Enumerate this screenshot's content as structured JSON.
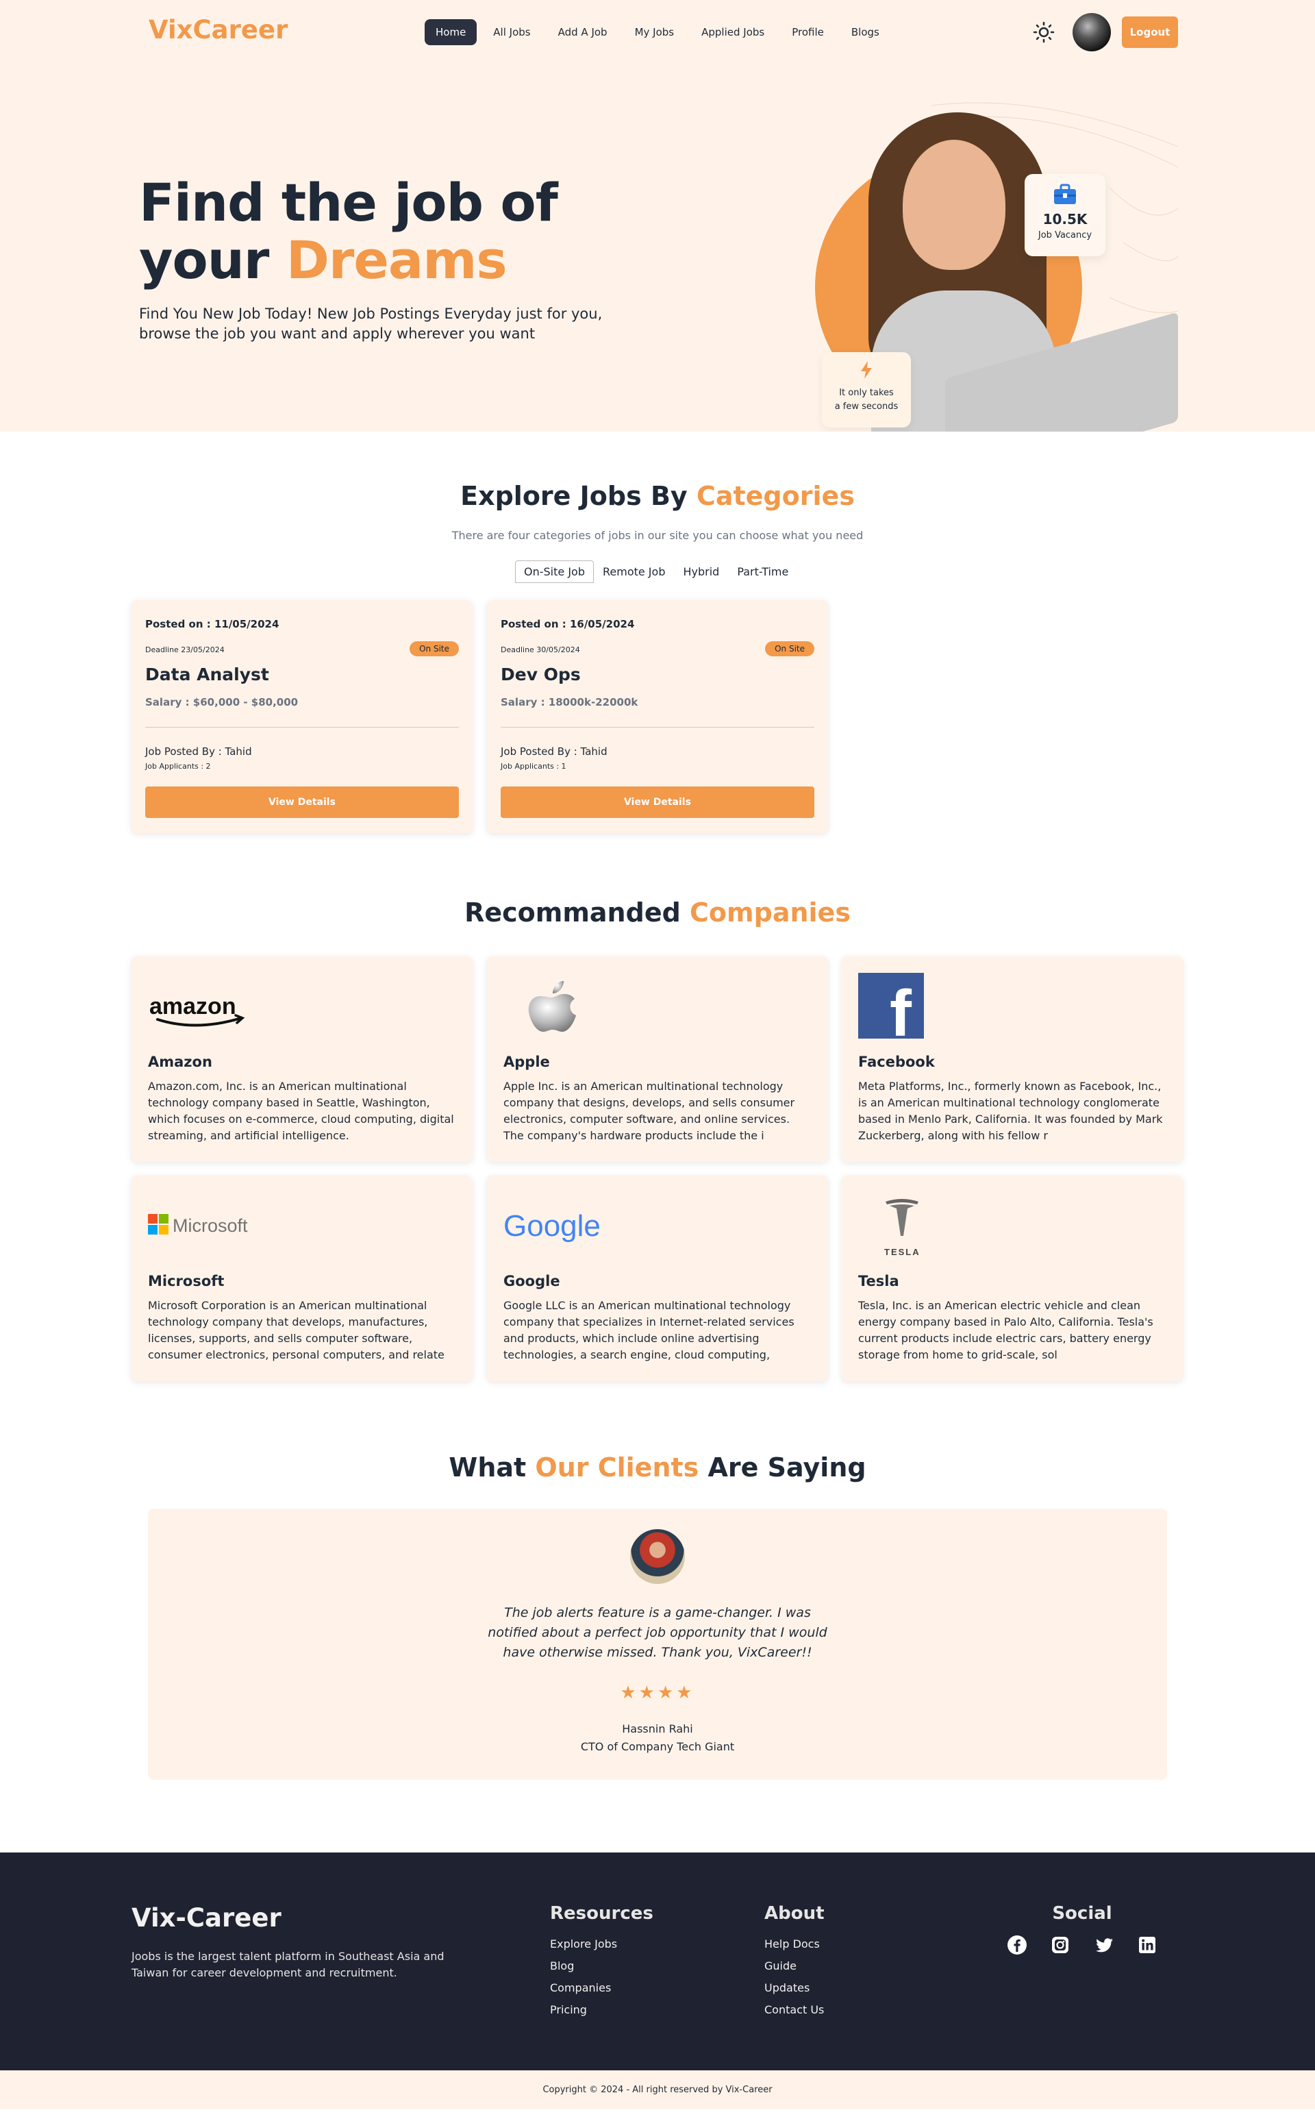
{
  "nav": {
    "brand": "VixCareer",
    "items": [
      "Home",
      "All Jobs",
      "Add A Job",
      "My Jobs",
      "Applied Jobs",
      "Profile",
      "Blogs"
    ],
    "active": "Home",
    "logout_label": "Logout"
  },
  "hero": {
    "title_line1": "Find the job of",
    "title_line2_plain": "your ",
    "title_line2_accent": "Dreams",
    "subtitle": "Find You New Job Today! New Job Postings Everyday just for you, browse the job you want and apply wherever you want",
    "vacancy_count": "10.5K",
    "vacancy_label": "Job Vacancy",
    "fast_label_line1": "It only takes",
    "fast_label_line2": "a few seconds"
  },
  "categories": {
    "title_plain": "Explore Jobs By ",
    "title_accent": "Categories",
    "subtitle": "There are four categories of jobs in our site you can choose what you need",
    "tabs": [
      "On-Site Job",
      "Remote Job",
      "Hybrid",
      "Part-Time"
    ],
    "active_tab": "On-Site Job",
    "jobs": [
      {
        "posted": "Posted on : 11/05/2024",
        "deadline": "Deadline 23/05/2024",
        "tag": "On Site",
        "title": "Data Analyst",
        "salary": "Salary : $60,000 - $80,000",
        "posted_by": "Job Posted By : Tahid",
        "applicants": "Job Applicants : 2",
        "button": "View Details"
      },
      {
        "posted": "Posted on : 16/05/2024",
        "deadline": "Deadline 30/05/2024",
        "tag": "On Site",
        "title": "Dev Ops",
        "salary": "Salary : 18000k-22000k",
        "posted_by": "Job Posted By : Tahid",
        "applicants": "Job Applicants : 1",
        "button": "View Details"
      }
    ]
  },
  "companies": {
    "title_plain": "Recommanded ",
    "title_accent": "Companies",
    "items": [
      {
        "name": "Amazon",
        "logo": "amazon-logo",
        "logo_text": "amazon",
        "desc": "Amazon.com, Inc. is an American multinational technology company based in Seattle, Washington, which focuses on e-commerce, cloud computing, digital streaming, and artificial intelligence."
      },
      {
        "name": "Apple",
        "logo": "apple-logo",
        "logo_text": "",
        "desc": "Apple Inc. is an American multinational technology company that designs, develops, and sells consumer electronics, computer software, and online services. The company's hardware products include the i"
      },
      {
        "name": "Facebook",
        "logo": "facebook-logo",
        "logo_text": "f",
        "desc": "Meta Platforms, Inc., formerly known as Facebook, Inc., is an American multinational technology conglomerate based in Menlo Park, California. It was founded by Mark Zuckerberg, along with his fellow r"
      },
      {
        "name": "Microsoft",
        "logo": "microsoft-logo",
        "logo_text": "Microsoft",
        "desc": "Microsoft Corporation is an American multinational technology company that develops, manufactures, licenses, supports, and sells computer software, consumer electronics, personal computers, and relate"
      },
      {
        "name": "Google",
        "logo": "google-logo",
        "logo_text": "Google",
        "desc": "Google LLC is an American multinational technology company that specializes in Internet-related services and products, which include online advertising technologies, a search engine, cloud computing,"
      },
      {
        "name": "Tesla",
        "logo": "tesla-logo",
        "logo_text": "TESLA",
        "desc": "Tesla, Inc. is an American electric vehicle and clean energy company based in Palo Alto, California. Tesla's current products include electric cars, battery energy storage from home to grid-scale, sol"
      }
    ]
  },
  "testimonials": {
    "title_plain1": "What ",
    "title_accent": "Our Clients",
    "title_plain2": " Are Saying",
    "quote": "The job alerts feature is a game-changer. I was notified about a perfect job opportunity that I would have otherwise missed. Thank you, VixCareer!!",
    "stars": 4,
    "stars_text": "★★★★",
    "name": "Hassnin Rahi",
    "role": "CTO of Company Tech Giant"
  },
  "footer": {
    "brand": "Vix-Career",
    "about": "Joobs is the largest talent platform in Southeast Asia and Taiwan for career development and recruitment.",
    "resources_title": "Resources",
    "resources": [
      "Explore Jobs",
      "Blog",
      "Companies",
      "Pricing"
    ],
    "about_title": "About",
    "about_links": [
      "Help Docs",
      "Guide",
      "Updates",
      "Contact Us"
    ],
    "social_title": "Social",
    "social_icons": [
      "facebook-icon",
      "instagram-icon",
      "twitter-icon",
      "linkedin-icon"
    ],
    "copyright": "Copyright © 2024 - All right reserved by Vix-Career"
  },
  "colors": {
    "accent": "#f2994a",
    "cream": "#fff3e9",
    "dark": "#1f2230",
    "text": "#1f2937"
  }
}
